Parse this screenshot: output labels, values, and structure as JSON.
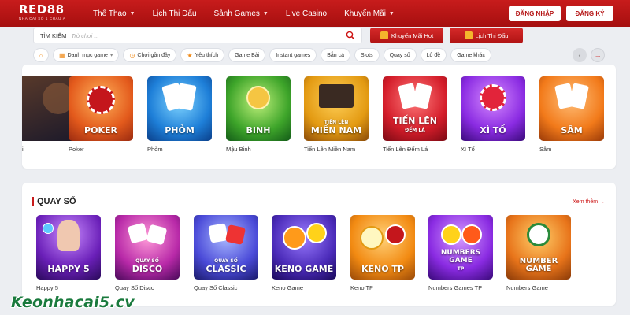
{
  "brand": {
    "logo": "RED88",
    "tagline": "NHÀ CÁI SỐ 1 CHÂU Á"
  },
  "nav": [
    {
      "label": "Thể Thao",
      "dropdown": true
    },
    {
      "label": "Lịch Thi Đấu",
      "dropdown": false
    },
    {
      "label": "Sảnh Games",
      "dropdown": true
    },
    {
      "label": "Live Casino",
      "dropdown": false
    },
    {
      "label": "Khuyến Mãi",
      "dropdown": true
    }
  ],
  "auth": {
    "login": "ĐĂNG NHẬP",
    "register": "ĐĂNG KÝ"
  },
  "search": {
    "label": "TÌM KIẾM",
    "placeholder": "Trò chơi ..."
  },
  "actions": {
    "promo": "Khuyến Mãi Hot",
    "schedule": "Lịch Thi Đấu"
  },
  "chips": [
    {
      "label": "",
      "icon": "home-icon"
    },
    {
      "label": "Danh mục game",
      "icon": "grid-icon"
    },
    {
      "label": "Chơi gần đây",
      "icon": "clock-icon"
    },
    {
      "label": "Yêu thích",
      "icon": "star-icon"
    },
    {
      "label": "Game Bài"
    },
    {
      "label": "Instant games"
    },
    {
      "label": "Bắn cá"
    },
    {
      "label": "Slots"
    },
    {
      "label": "Quay số"
    },
    {
      "label": "Lô đề"
    },
    {
      "label": "Game khác"
    }
  ],
  "card_games": [
    {
      "name": "i",
      "art": "",
      "sub": ""
    },
    {
      "name": "Poker",
      "art": "POKER",
      "sub": ""
    },
    {
      "name": "Phỏm",
      "art": "PHỎM",
      "sub": ""
    },
    {
      "name": "Mậu Binh",
      "art": "BINH",
      "sub": ""
    },
    {
      "name": "Tiến Lên Miền Nam",
      "art": "MIỀN NAM",
      "sub": "TIẾN LÊN"
    },
    {
      "name": "Tiến Lên Đếm Lá",
      "art": "TIẾN LÊN",
      "sub": "ĐẾM LÁ"
    },
    {
      "name": "Xì Tố",
      "art": "XÌ TỐ",
      "sub": ""
    },
    {
      "name": "Sâm",
      "art": "SÂM",
      "sub": ""
    }
  ],
  "lottery": {
    "title": "QUAY SỐ",
    "see_more": "Xem thêm",
    "items": [
      {
        "name": "Happy 5",
        "art": "HAPPY 5",
        "sub": ""
      },
      {
        "name": "Quay Số Disco",
        "art": "DISCO",
        "sub": "QUAY SỐ"
      },
      {
        "name": "Quay Số Classic",
        "art": "CLASSIC",
        "sub": "QUAY SỐ"
      },
      {
        "name": "Keno Game",
        "art": "KENO GAME",
        "sub": ""
      },
      {
        "name": "Keno TP",
        "art": "KENO TP",
        "sub": ""
      },
      {
        "name": "Numbers Games TP",
        "art": "NUMBERS GAME",
        "sub": "TP"
      },
      {
        "name": "Numbers Game",
        "art": "NUMBER GAME",
        "sub": ""
      }
    ]
  },
  "watermark": "Keonhacai5.cv",
  "colors": {
    "brand_red": "#c81c1c",
    "watermark_green": "#1a7a3d"
  }
}
